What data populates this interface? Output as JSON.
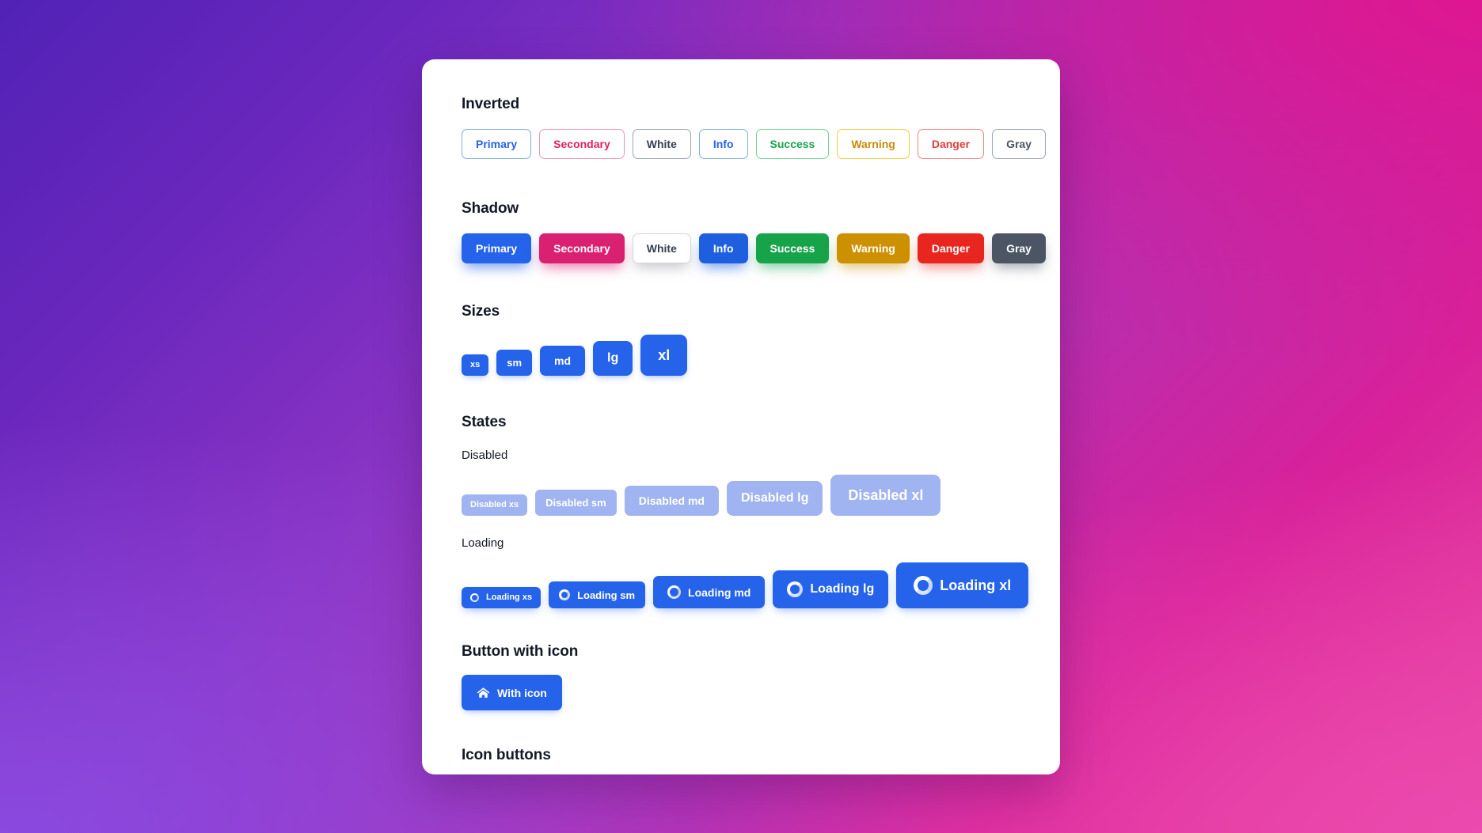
{
  "background": {
    "gradient_from": "#5122b6",
    "gradient_mid": "#b52fb0",
    "gradient_to": "#e8459f"
  },
  "card": {
    "background": "#ffffff"
  },
  "sections": {
    "inverted": {
      "title": "Inverted",
      "buttons": [
        {
          "label": "Primary",
          "variant": "inv-primary",
          "color": "#2563eb"
        },
        {
          "label": "Secondary",
          "variant": "inv-secondary",
          "color": "#e0215f"
        },
        {
          "label": "White",
          "variant": "inv-white",
          "color": "#374151"
        },
        {
          "label": "Info",
          "variant": "inv-info",
          "color": "#2563eb"
        },
        {
          "label": "Success",
          "variant": "inv-success",
          "color": "#17a34a"
        },
        {
          "label": "Warning",
          "variant": "inv-warning",
          "color": "#c98a05"
        },
        {
          "label": "Danger",
          "variant": "inv-danger",
          "color": "#e23b3b"
        },
        {
          "label": "Gray",
          "variant": "inv-gray",
          "color": "#4b5563"
        }
      ]
    },
    "shadow": {
      "title": "Shadow",
      "buttons": [
        {
          "label": "Primary",
          "variant": "sh-primary",
          "color": "#2563eb"
        },
        {
          "label": "Secondary",
          "variant": "sh-secondary",
          "color": "#da2070"
        },
        {
          "label": "White",
          "variant": "sh-white",
          "color": "#ffffff"
        },
        {
          "label": "Info",
          "variant": "sh-info",
          "color": "#1e5fe0"
        },
        {
          "label": "Success",
          "variant": "sh-success",
          "color": "#17a34a"
        },
        {
          "label": "Warning",
          "variant": "sh-warning",
          "color": "#cc9000"
        },
        {
          "label": "Danger",
          "variant": "sh-danger",
          "color": "#e8261f"
        },
        {
          "label": "Gray",
          "variant": "sh-gray",
          "color": "#4b5563"
        }
      ]
    },
    "sizes": {
      "title": "Sizes",
      "buttons": [
        {
          "label": "xs",
          "size": "xs"
        },
        {
          "label": "sm",
          "size": "sm"
        },
        {
          "label": "md",
          "size": "md"
        },
        {
          "label": "lg",
          "size": "lg"
        },
        {
          "label": "xl",
          "size": "xl"
        }
      ]
    },
    "states": {
      "title": "States",
      "disabled": {
        "label": "Disabled",
        "buttons": [
          {
            "label": "Disabled xs",
            "size": "xs"
          },
          {
            "label": "Disabled sm",
            "size": "sm"
          },
          {
            "label": "Disabled md",
            "size": "md"
          },
          {
            "label": "Disabled lg",
            "size": "lg"
          },
          {
            "label": "Disabled xl",
            "size": "xl"
          }
        ],
        "color": "#9fb4f0"
      },
      "loading": {
        "label": "Loading",
        "buttons": [
          {
            "label": "Loading xs",
            "size": "xs"
          },
          {
            "label": "Loading sm",
            "size": "sm"
          },
          {
            "label": "Loading md",
            "size": "md"
          },
          {
            "label": "Loading lg",
            "size": "lg"
          },
          {
            "label": "Loading xl",
            "size": "xl"
          }
        ],
        "color": "#2563eb"
      }
    },
    "button_with_icon": {
      "title": "Button with icon",
      "button": {
        "label": "With icon",
        "icon": "home-icon",
        "color": "#2563eb"
      }
    },
    "icon_buttons": {
      "title": "Icon buttons",
      "buttons": [
        {
          "icon": "clock-icon",
          "color": "#2563eb"
        },
        {
          "icon": "clock-icon",
          "color": "#da2070"
        },
        {
          "icon": "clock-icon",
          "color": "#4b5563"
        },
        {
          "icon": "trash-icon",
          "color": "#2563eb"
        },
        {
          "icon": "trash-icon",
          "color": "#17a34a"
        },
        {
          "icon": "arrow-up-circle-icon",
          "color": "#cc9000"
        },
        {
          "icon": "arrow-up-circle-icon",
          "color": "#e8261f"
        },
        {
          "icon": "download-icon",
          "color": "#a5d6af"
        },
        {
          "icon": "spinner-icon",
          "color": "#cfd2f5"
        },
        {
          "icon": "trash-icon",
          "color": "#4f46e5"
        }
      ]
    }
  }
}
